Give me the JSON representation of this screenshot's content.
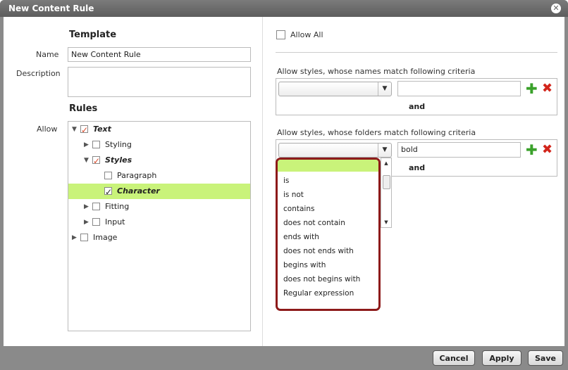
{
  "dialog": {
    "title": "New Content Rule"
  },
  "template": {
    "heading": "Template",
    "name_label": "Name",
    "name_value": "New Content Rule",
    "description_label": "Description",
    "description_value": ""
  },
  "rules": {
    "heading": "Rules",
    "allow_label": "Allow",
    "tree": [
      {
        "label": "Text",
        "checked": true,
        "expanded": true
      },
      {
        "label": "Styling",
        "checked": false,
        "expanded": false
      },
      {
        "label": "Styles",
        "checked": true,
        "expanded": true
      },
      {
        "label": "Paragraph",
        "checked": false
      },
      {
        "label": "Character",
        "checked": true,
        "selected": true
      },
      {
        "label": "Fitting",
        "checked": false,
        "expanded": false
      },
      {
        "label": "Input",
        "checked": false,
        "expanded": false
      },
      {
        "label": "Image",
        "checked": false,
        "expanded": false
      }
    ]
  },
  "right": {
    "allow_all_label": "Allow All",
    "names_criteria_label": "Allow styles, whose names match following criteria",
    "names_select_value": "",
    "names_text_value": "",
    "names_and": "and",
    "folders_criteria_label": "Allow styles, whose folders match following criteria",
    "folders_select_value": "",
    "folders_text_value": "bold",
    "folders_and": "and"
  },
  "dropdown_options": [
    "",
    "is",
    "is not",
    "contains",
    "does not contain",
    "ends with",
    "does not ends with",
    "begins with",
    "does not begins with",
    "Regular expression"
  ],
  "buttons": {
    "cancel": "Cancel",
    "apply": "Apply",
    "save": "Save"
  }
}
